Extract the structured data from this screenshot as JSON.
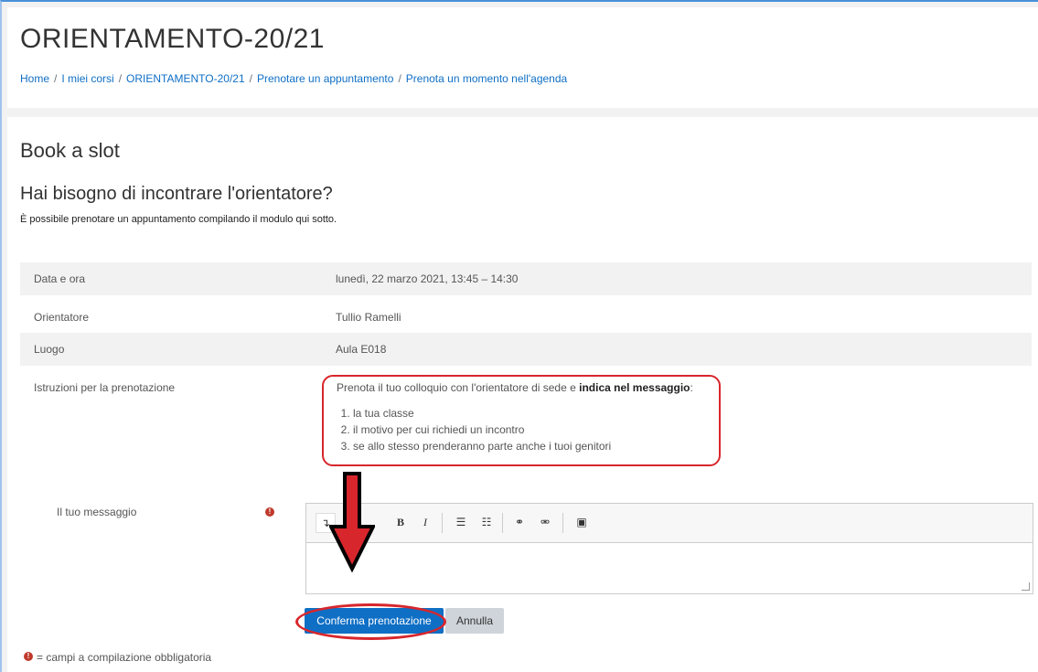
{
  "header": {
    "title": "ORIENTAMENTO-20/21",
    "breadcrumb": [
      "Home",
      "I miei corsi",
      "ORIENTAMENTO-20/21",
      "Prenotare un appuntamento",
      "Prenota un momento nell'agenda"
    ]
  },
  "main": {
    "heading": "Book a slot",
    "subheading": "Hai bisogno di incontrare l'orientatore?",
    "intro": "È possibile prenotare un appuntamento compilando il modulo qui sotto.",
    "details": [
      {
        "label": "Data e ora",
        "value": "lunedì, 22 marzo 2021, 13:45 – 14:30"
      },
      {
        "label": "Orientatore",
        "value": "Tullio Ramelli"
      },
      {
        "label": "Luogo",
        "value": "Aula E018"
      }
    ],
    "instructions": {
      "label": "Istruzioni per la prenotazione",
      "text_before": "Prenota il tuo colloquio con l'orientatore di sede e ",
      "text_bold": "indica nel messaggio",
      "text_after": ":",
      "items": [
        "la tua classe",
        "il motivo per cui richiedi un incontro",
        "se allo stesso prenderanno parte anche i tuoi genitori"
      ]
    },
    "message": {
      "label": "Il tuo messaggio",
      "value": ""
    },
    "buttons": {
      "confirm": "Conferma prenotazione",
      "cancel": "Annulla"
    },
    "legend": "= campi a compilazione obbligatoria"
  },
  "icons": {
    "required": "exclamation-circle-icon",
    "toolbar": [
      "collapse-icon",
      "bold-icon",
      "italic-icon",
      "unordered-list-icon",
      "ordered-list-icon",
      "link-icon",
      "unlink-icon",
      "image-icon"
    ]
  },
  "colors": {
    "link": "#0f6fc5",
    "primary_button": "#0f6fc5",
    "required": "#c0392b",
    "annotation": "#d7262c"
  }
}
